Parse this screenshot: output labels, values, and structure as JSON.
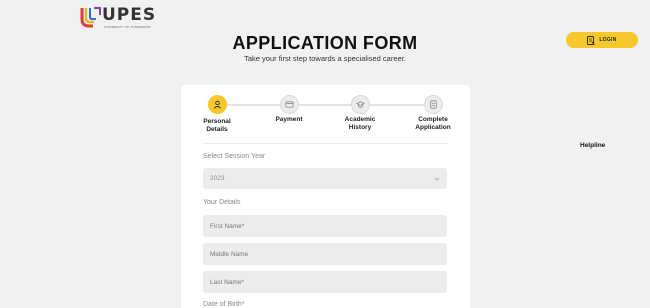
{
  "header": {
    "logo_text": "UPES",
    "logo_tagline": "UNIVERSITY OF TOMORROW",
    "login_label": "LOGIN"
  },
  "page": {
    "title": "APPLICATION FORM",
    "subtitle": "Take your first step towards a specialised career.",
    "helpline": "Helpline"
  },
  "steps": [
    {
      "label_line1": "Personal",
      "label_line2": "Details",
      "icon": "user-icon",
      "active": true
    },
    {
      "label_line1": "Payment",
      "label_line2": "",
      "icon": "payment-icon",
      "active": false
    },
    {
      "label_line1": "Academic",
      "label_line2": "History",
      "icon": "graduation-cap-icon",
      "active": false
    },
    {
      "label_line1": "Complete",
      "label_line2": "Application",
      "icon": "document-icon",
      "active": false
    }
  ],
  "form": {
    "session_label": "Select Session Year",
    "session_value": "2023",
    "details_label": "Your Details",
    "first_name_placeholder": "First Name*",
    "middle_name_placeholder": "Middle Name",
    "last_name_placeholder": "Last Name*",
    "dob_label": "Date of Birth*"
  },
  "colors": {
    "accent": "#f6c829",
    "background": "#f1f1f1",
    "field_bg": "#ececec"
  }
}
